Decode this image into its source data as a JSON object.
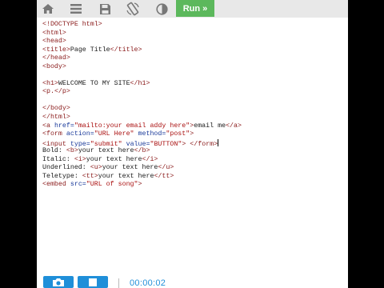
{
  "toolbar": {
    "icons": [
      "home-icon",
      "menu-icon",
      "save-icon",
      "rotate-icon",
      "contrast-icon"
    ],
    "run_label": "Run »",
    "accent_color": "#5cb85c"
  },
  "editor": {
    "lines": [
      [
        {
          "t": "tag",
          "v": "<!DOCTYPE html>"
        }
      ],
      [
        {
          "t": "tag",
          "v": "<html>"
        }
      ],
      [
        {
          "t": "tag",
          "v": "<head>"
        }
      ],
      [
        {
          "t": "tag",
          "v": "<title>"
        },
        {
          "t": "plain",
          "v": "Page Title"
        },
        {
          "t": "tag",
          "v": "</title>"
        }
      ],
      [
        {
          "t": "tag",
          "v": "</head>"
        }
      ],
      [
        {
          "t": "tag",
          "v": "<body>"
        }
      ],
      [],
      [
        {
          "t": "tag",
          "v": "<h1>"
        },
        {
          "t": "plain",
          "v": "WELCOME TO MY SITE"
        },
        {
          "t": "tag",
          "v": "</h1>"
        }
      ],
      [
        {
          "t": "tag",
          "v": "<p."
        },
        {
          "t": "tag",
          "v": "</p>"
        }
      ],
      [],
      [
        {
          "t": "tag",
          "v": "</body>"
        }
      ],
      [
        {
          "t": "tag",
          "v": "</html>"
        }
      ],
      [
        {
          "t": "tag",
          "v": "<a "
        },
        {
          "t": "attr",
          "v": "href="
        },
        {
          "t": "str",
          "v": "\"mailto:your email addy here\""
        },
        {
          "t": "tag",
          "v": ">"
        },
        {
          "t": "plain",
          "v": "email me"
        },
        {
          "t": "tag",
          "v": "</a>"
        }
      ],
      [
        {
          "t": "tag",
          "v": "<form "
        },
        {
          "t": "attr",
          "v": "action="
        },
        {
          "t": "str",
          "v": "\"URL Here\""
        },
        {
          "t": "attr",
          "v": " method="
        },
        {
          "t": "str",
          "v": "\"post\""
        },
        {
          "t": "tag",
          "v": ">"
        }
      ],
      [
        {
          "t": "tag",
          "v": "<input "
        },
        {
          "t": "attr",
          "v": "type="
        },
        {
          "t": "str",
          "v": "\"submit\""
        },
        {
          "t": "attr",
          "v": " value="
        },
        {
          "t": "str",
          "v": "\"BUTTON\""
        },
        {
          "t": "tag",
          "v": ">"
        },
        {
          "t": "plain",
          "v": " "
        },
        {
          "t": "tag",
          "v": "</form>"
        },
        {
          "t": "cursor",
          "v": ""
        }
      ],
      [
        {
          "t": "plain",
          "v": "Bold: "
        },
        {
          "t": "tag",
          "v": "<b>"
        },
        {
          "t": "plain",
          "v": "your text here"
        },
        {
          "t": "tag",
          "v": "</b>"
        }
      ],
      [
        {
          "t": "plain",
          "v": "Italic: "
        },
        {
          "t": "tag",
          "v": "<i>"
        },
        {
          "t": "plain",
          "v": "your text here"
        },
        {
          "t": "tag",
          "v": "</i>"
        }
      ],
      [
        {
          "t": "plain",
          "v": "Underlined: "
        },
        {
          "t": "tag",
          "v": "<u>"
        },
        {
          "t": "plain",
          "v": "your text here"
        },
        {
          "t": "tag",
          "v": "</u>"
        }
      ],
      [
        {
          "t": "plain",
          "v": "Teletype: "
        },
        {
          "t": "tag",
          "v": "<tt>"
        },
        {
          "t": "plain",
          "v": "your text here"
        },
        {
          "t": "tag",
          "v": "</tt>"
        }
      ],
      [
        {
          "t": "tag",
          "v": "<embed "
        },
        {
          "t": "attr",
          "v": "src="
        },
        {
          "t": "str",
          "v": "\"URL of song\""
        },
        {
          "t": "tag",
          "v": ">"
        }
      ]
    ]
  },
  "recorder": {
    "icons": [
      "camera-icon",
      "stop-icon"
    ],
    "timer": "00:00:02",
    "accent_color": "#1f8fd9"
  }
}
